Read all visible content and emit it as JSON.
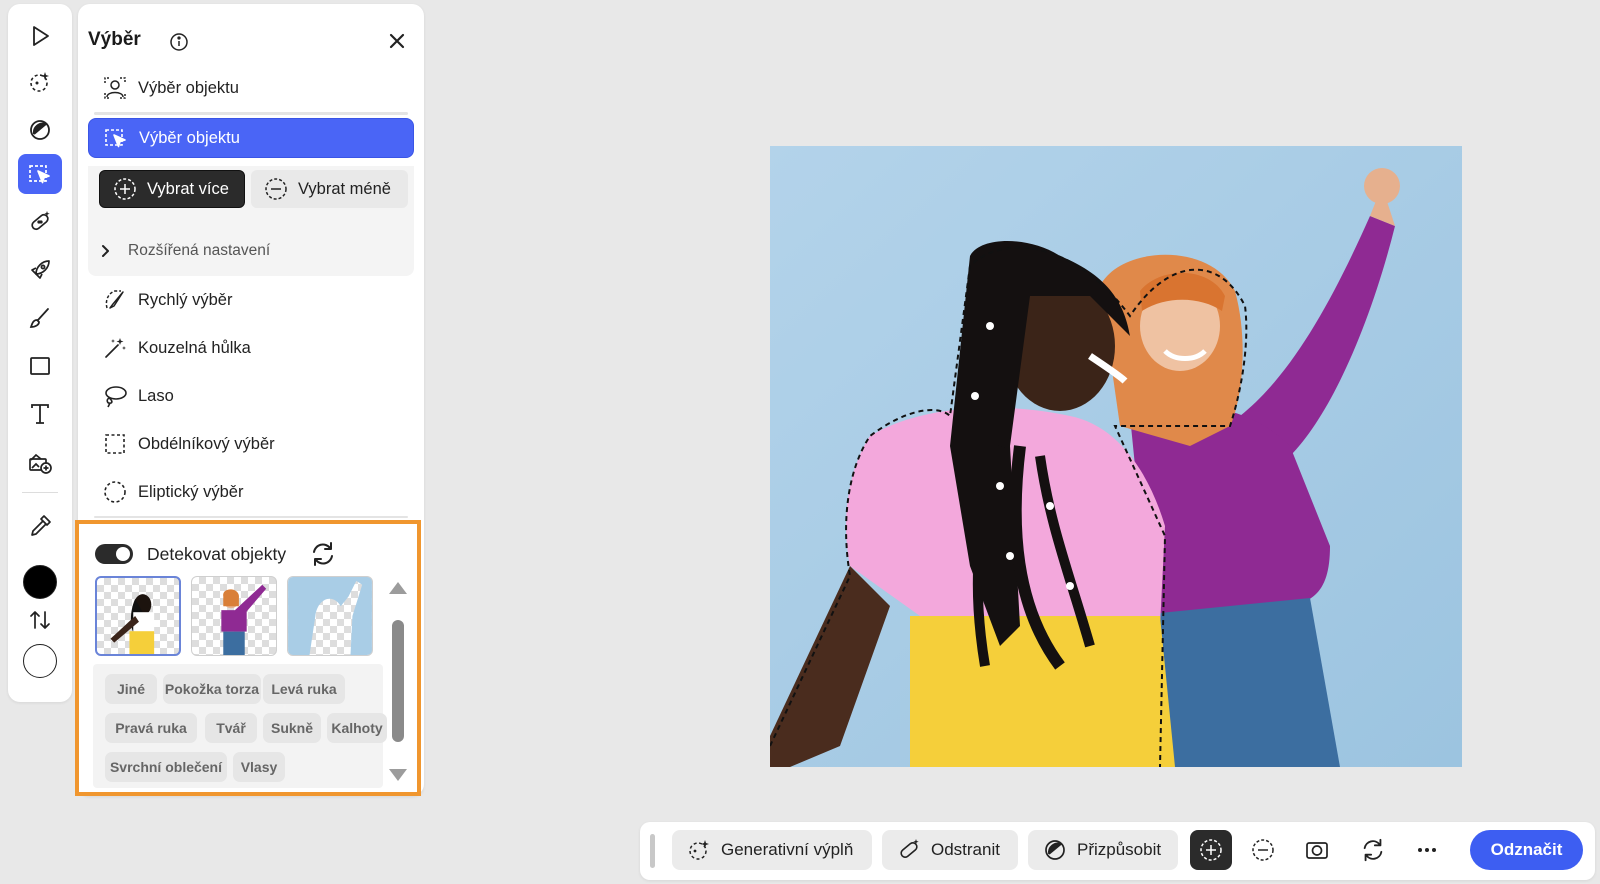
{
  "rail": {
    "tools": [
      {
        "name": "arrow-pointer-icon"
      },
      {
        "name": "generative-select-icon"
      },
      {
        "name": "adjust-icon"
      },
      {
        "name": "object-select-icon",
        "active": true
      },
      {
        "name": "healing-bandage-icon"
      },
      {
        "name": "rocket-icon"
      },
      {
        "name": "brush-icon"
      },
      {
        "name": "rectangle-icon"
      },
      {
        "name": "text-icon"
      },
      {
        "name": "add-image-icon"
      },
      {
        "name": "eyedropper-icon"
      }
    ],
    "foreground_color": "#000000",
    "background_color": "#ffffff"
  },
  "panel": {
    "title": "Výběr",
    "top_item": "Výběr objektu",
    "active_item": "Výběr objektu",
    "select_more": "Vybrat více",
    "select_less": "Vybrat méně",
    "advanced": "Rozšířená nastavení",
    "items": [
      {
        "label": "Rychlý výběr",
        "icon": "quick-select-icon"
      },
      {
        "label": "Kouzelná hůlka",
        "icon": "magic-wand-icon"
      },
      {
        "label": "Laso",
        "icon": "lasso-icon"
      },
      {
        "label": "Obdélníkový výběr",
        "icon": "rectangle-marquee-icon"
      },
      {
        "label": "Eliptický výběr",
        "icon": "ellipse-marquee-icon"
      }
    ]
  },
  "detect": {
    "label": "Detekovat objekty",
    "toggle_on": true,
    "tags": [
      "Jiné",
      "Pokožka torza",
      "Levá ruka",
      "Pravá ruka",
      "Tvář",
      "Sukně",
      "Kalhoty",
      "Svrchní oblečení",
      "Vlasy"
    ]
  },
  "toolbar": {
    "generative_fill": "Generativní výplň",
    "remove": "Odstranit",
    "adjust": "Přizpůsobit",
    "deselect": "Odznačit"
  },
  "colors": {
    "accent": "#4a65f6",
    "highlight_border": "#f0962e",
    "photo_background": "#a9cde6",
    "pink_top": "#f3a8dc",
    "yellow_pants": "#f5cf3a",
    "purple_jacket": "#8f2a93",
    "jeans": "#3c6ea0"
  }
}
